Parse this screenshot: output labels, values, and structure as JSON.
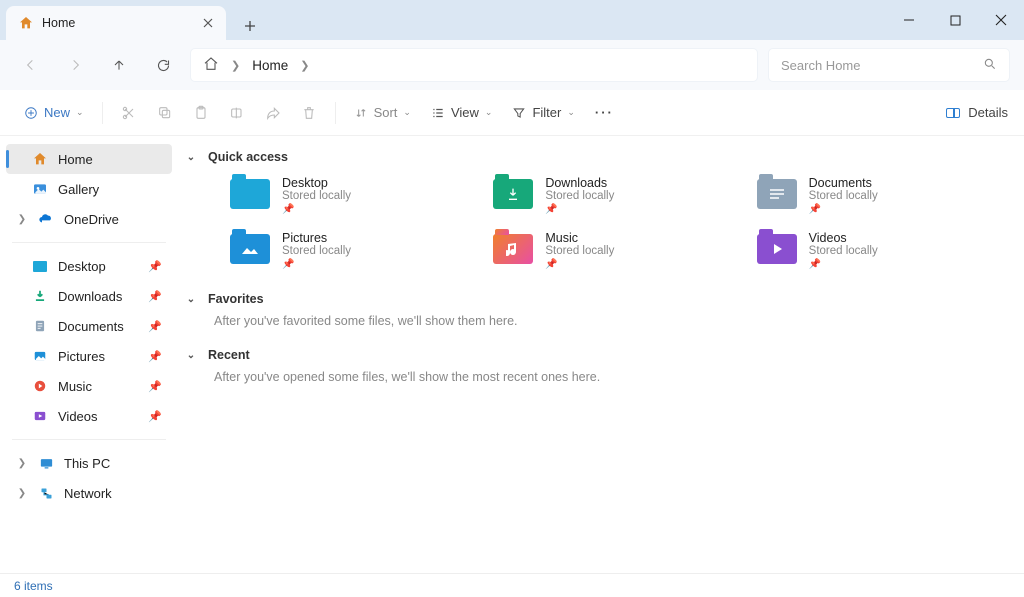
{
  "tab": {
    "title": "Home"
  },
  "address": {
    "location": "Home"
  },
  "search": {
    "placeholder": "Search Home"
  },
  "toolbar": {
    "new": "New",
    "sort": "Sort",
    "view": "View",
    "filter": "Filter",
    "details": "Details"
  },
  "sidebar": {
    "top": [
      {
        "label": "Home"
      },
      {
        "label": "Gallery"
      },
      {
        "label": "OneDrive"
      }
    ],
    "pinned": [
      {
        "label": "Desktop"
      },
      {
        "label": "Downloads"
      },
      {
        "label": "Documents"
      },
      {
        "label": "Pictures"
      },
      {
        "label": "Music"
      },
      {
        "label": "Videos"
      }
    ],
    "bottom": [
      {
        "label": "This PC"
      },
      {
        "label": "Network"
      }
    ]
  },
  "sections": {
    "quick_access": {
      "title": "Quick access",
      "items": [
        {
          "name": "Desktop",
          "sub": "Stored locally"
        },
        {
          "name": "Downloads",
          "sub": "Stored locally"
        },
        {
          "name": "Documents",
          "sub": "Stored locally"
        },
        {
          "name": "Pictures",
          "sub": "Stored locally"
        },
        {
          "name": "Music",
          "sub": "Stored locally"
        },
        {
          "name": "Videos",
          "sub": "Stored locally"
        }
      ]
    },
    "favorites": {
      "title": "Favorites",
      "empty": "After you've favorited some files, we'll show them here."
    },
    "recent": {
      "title": "Recent",
      "empty": "After you've opened some files, we'll show the most recent ones here."
    }
  },
  "status": {
    "text": "6 items"
  },
  "colors": {
    "desktop": "#1ea7d8",
    "downloads": "#17a87a",
    "documents": "#8fa4b8",
    "pictures": "#1e90d8",
    "music": "#f07f2c",
    "videos": "#8a4fd0"
  }
}
